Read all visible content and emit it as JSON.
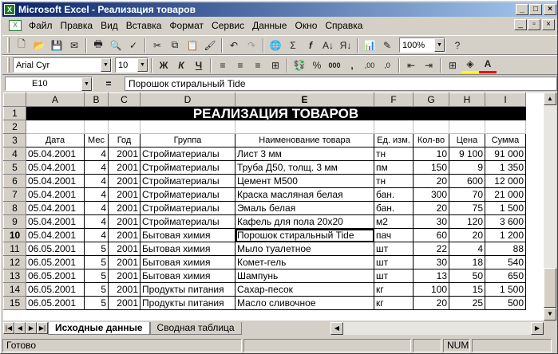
{
  "window": {
    "title": "Microsoft Excel - Реализация товаров",
    "app_icon": "excel-icon"
  },
  "menu": [
    "Файл",
    "Правка",
    "Вид",
    "Вставка",
    "Формат",
    "Сервис",
    "Данные",
    "Окно",
    "Справка"
  ],
  "toolbar": {
    "zoom": "100%",
    "font": "Arial Cyr",
    "size": "10",
    "bold": "Ж",
    "italic": "К",
    "underline": "Ч",
    "sigma": "Σ",
    "fx": "f",
    "percent": "%",
    "thousands": "000",
    "comma": ",",
    "inc_dec": ",00",
    "dec_dec": ",0"
  },
  "formula_bar": {
    "name_box": "E10",
    "equals": "=",
    "content": "Порошок стиральный Tide"
  },
  "columns": [
    "A",
    "B",
    "C",
    "D",
    "E",
    "F",
    "G",
    "H",
    "I"
  ],
  "sheet": {
    "title": "РЕАЛИЗАЦИЯ ТОВАРОВ",
    "headers": [
      "Дата",
      "Мес",
      "Год",
      "Группа",
      "Наименование товара",
      "Ед. изм.",
      "Кол-во",
      "Цена",
      "Сумма"
    ],
    "rows": [
      [
        "05.04.2001",
        "4",
        "2001",
        "Стройматериалы",
        "Лист 3 мм",
        "тн",
        "10",
        "9 100",
        "91 000"
      ],
      [
        "05.04.2001",
        "4",
        "2001",
        "Стройматериалы",
        "Труба Д50, толщ. 3 мм",
        "пм",
        "150",
        "9",
        "1 350"
      ],
      [
        "05.04.2001",
        "4",
        "2001",
        "Стройматериалы",
        "Цемент М500",
        "тн",
        "20",
        "600",
        "12 000"
      ],
      [
        "05.04.2001",
        "4",
        "2001",
        "Стройматериалы",
        "Краска масляная белая",
        "бан.",
        "300",
        "70",
        "21 000"
      ],
      [
        "05.04.2001",
        "4",
        "2001",
        "Стройматериалы",
        "Эмаль белая",
        "бан.",
        "20",
        "75",
        "1 500"
      ],
      [
        "05.04.2001",
        "4",
        "2001",
        "Стройматериалы",
        "Кафель для пола 20x20",
        "м2",
        "30",
        "120",
        "3 600"
      ],
      [
        "05.04.2001",
        "4",
        "2001",
        "Бытовая химия",
        "Порошок стиральный Tide",
        "пач",
        "60",
        "20",
        "1 200"
      ],
      [
        "06.05.2001",
        "5",
        "2001",
        "Бытовая химия",
        "Мыло туалетное",
        "шт",
        "22",
        "4",
        "88"
      ],
      [
        "06.05.2001",
        "5",
        "2001",
        "Бытовая химия",
        "Комет-гель",
        "шт",
        "30",
        "18",
        "540"
      ],
      [
        "06.05.2001",
        "5",
        "2001",
        "Бытовая химия",
        "Шампунь",
        "шт",
        "13",
        "50",
        "650"
      ],
      [
        "06.05.2001",
        "5",
        "2001",
        "Продукты питания",
        "Сахар-песок",
        "кг",
        "100",
        "15",
        "1 500"
      ],
      [
        "06.05.2001",
        "5",
        "2001",
        "Продукты питания",
        "Масло сливочное",
        "кг",
        "20",
        "25",
        "500"
      ]
    ]
  },
  "tabs": [
    "Исходные данные",
    "Сводная таблица"
  ],
  "status": {
    "ready": "Готово",
    "num": "NUM"
  },
  "colors": {
    "title_bar_start": "#0a246a",
    "title_bar_end": "#a6caf0",
    "chrome": "#d4d0c8"
  }
}
